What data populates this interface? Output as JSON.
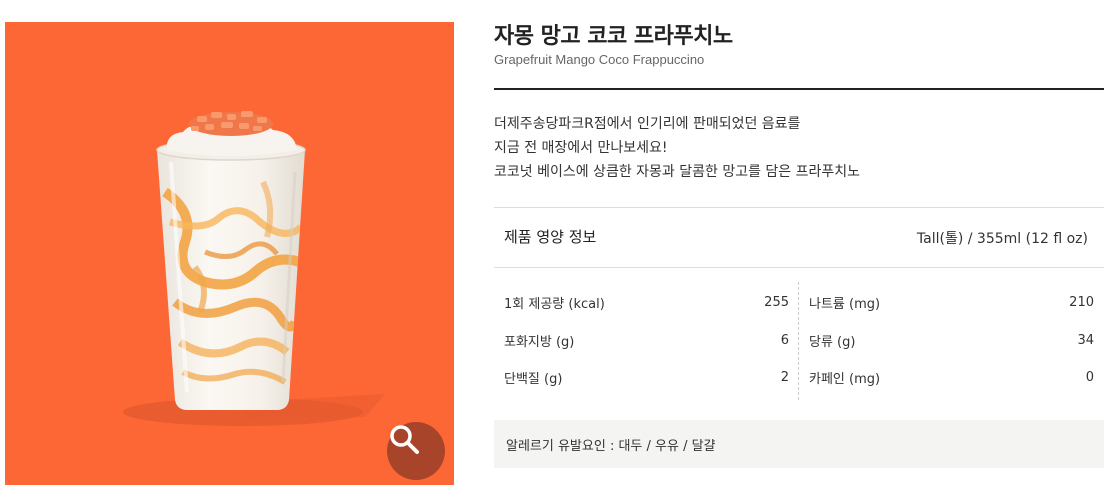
{
  "product": {
    "name_ko": "자몽 망고 코코 프라푸치노",
    "name_en": "Grapefruit Mango Coco Frappuccino",
    "description_lines": [
      "더제주송당파크R점에서 인기리에 판매되었던 음료를",
      "지금 전 매장에서 만나보세요!",
      "코코넛 베이스에 상큼한 자몽과 달콤한 망고를 담은 프라푸치노"
    ],
    "image_bg": "#fd6736"
  },
  "zoom": {
    "icon": "magnifier-icon",
    "bg": "#a8442a"
  },
  "nutrition": {
    "title": "제품 영양 정보",
    "serving": "Tall(톨) / 355ml (12 fl oz)",
    "left": [
      {
        "label": "1회 제공량 (kcal)",
        "value": "255"
      },
      {
        "label": "포화지방 (g)",
        "value": "6"
      },
      {
        "label": "단백질 (g)",
        "value": "2"
      }
    ],
    "right": [
      {
        "label": "나트륨 (mg)",
        "value": "210"
      },
      {
        "label": "당류 (g)",
        "value": "34"
      },
      {
        "label": "카페인 (mg)",
        "value": "0"
      }
    ]
  },
  "allergy": {
    "text": "알레르기 유발요인 : 대두 / 우유 / 달걀"
  }
}
